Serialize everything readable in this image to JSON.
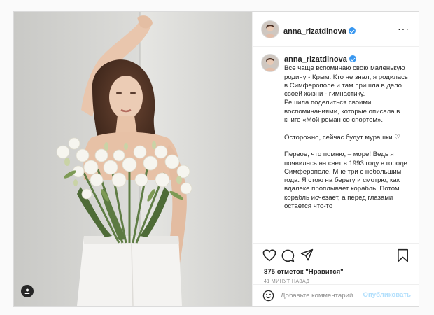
{
  "post": {
    "username": "anna_rizatdinova",
    "more_icon": "more-icon",
    "caption": {
      "lead": "Все чаще вспоминаю свою маленькую родину - Крым. Кто не знал, я родилась в Симферополе и там пришла в дело своей жизни - гимнастику.\nРешила поделиться своими воспоминаниями, которые описала в книге «Мой роман со спортом».",
      "p2": "Осторожно, сейчас будут мурашки ♡",
      "p3": "Первое, что помню, – море! Ведь я появилась на свет в 1993 году в городе Симферополе. Мне три с небольшим года. Я стою на берегу и смотрю, как вдалеке проплывает корабль. Потом корабль исчезает, а перед глазами остается что-то"
    },
    "likes_count": "875",
    "likes_text": "отметок \"Нравится\"",
    "time": "41 минут назад",
    "comment_placeholder": "Добавьте комментарий...",
    "publish_label": "Опубликовать",
    "icons": [
      "heart-icon",
      "comment-icon",
      "share-icon",
      "bookmark-icon",
      "emoji-icon",
      "user-tag-icon",
      "verified-badge-icon"
    ],
    "colors": {
      "accent": "#3897f0",
      "publish_disabled": "#b2dffc",
      "muted": "#8e8e8e",
      "text": "#262626",
      "border": "#dbdbdb"
    }
  }
}
